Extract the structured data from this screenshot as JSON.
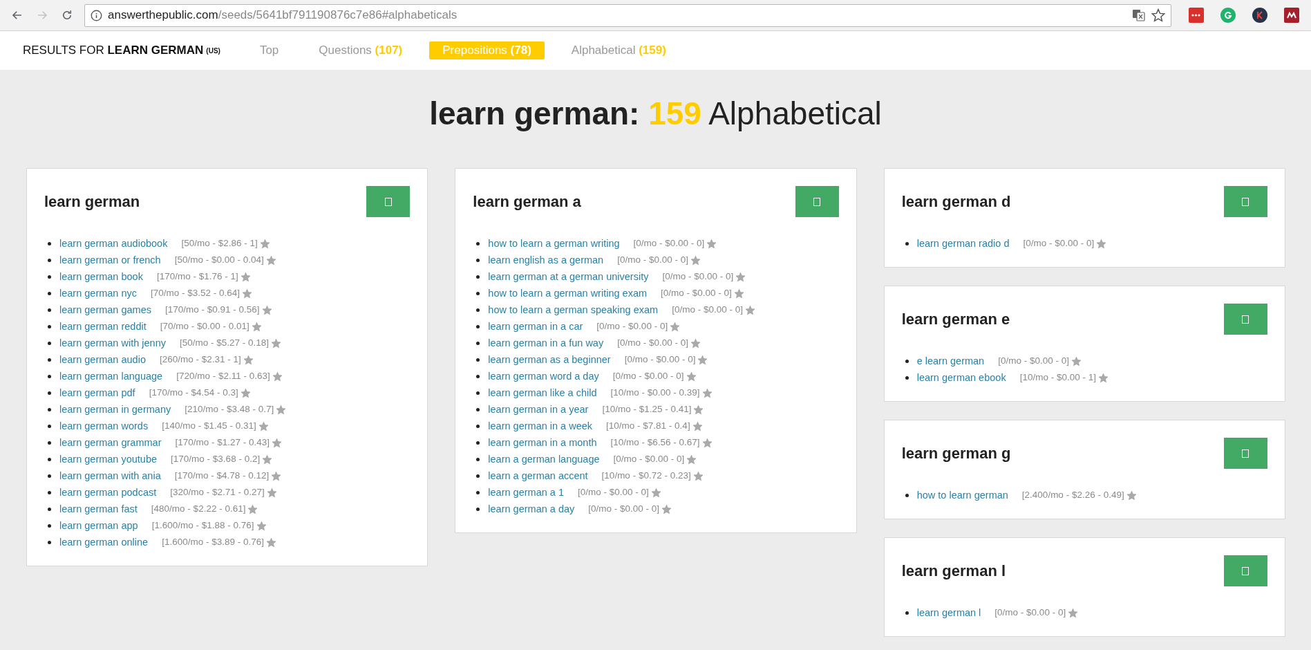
{
  "browser": {
    "url_host": "answerthepublic.com",
    "url_path": "/seeds/5641bf791190876c7e86#alphabeticals",
    "forward_disabled": true
  },
  "nav": {
    "results_label": "RESULTS FOR **LEARN GERMAN**",
    "region": "(US)",
    "tabs": [
      {
        "label": "Top",
        "selected": false
      },
      {
        "label": "Questions",
        "count": "(107)",
        "selected": false
      },
      {
        "label": "Prepositions",
        "count": "(78)",
        "selected": true
      },
      {
        "label": "Alphabetical",
        "count": "(159)",
        "selected": false
      }
    ]
  },
  "heading": {
    "seed": "learn german:",
    "count": "159",
    "label": "Alphabetical"
  },
  "columns": [
    [
      {
        "title": "learn german",
        "items": [
          {
            "phrase": "learn german audiobook",
            "stats": "[50/mo - $2.86 - 1]"
          },
          {
            "phrase": "learn german or french",
            "stats": "[50/mo - $0.00 - 0.04]"
          },
          {
            "phrase": "learn german book",
            "stats": "[170/mo - $1.76 - 1]"
          },
          {
            "phrase": "learn german nyc",
            "stats": "[70/mo - $3.52 - 0.64]"
          },
          {
            "phrase": "learn german games",
            "stats": "[170/mo - $0.91 - 0.56]"
          },
          {
            "phrase": "learn german reddit",
            "stats": "[70/mo - $0.00 - 0.01]"
          },
          {
            "phrase": "learn german with jenny",
            "stats": "[50/mo - $5.27 - 0.18]"
          },
          {
            "phrase": "learn german audio",
            "stats": "[260/mo - $2.31 - 1]"
          },
          {
            "phrase": "learn german language",
            "stats": "[720/mo - $2.11 - 0.63]"
          },
          {
            "phrase": "learn german pdf",
            "stats": "[170/mo - $4.54 - 0.3]"
          },
          {
            "phrase": "learn german in germany",
            "stats": "[210/mo - $3.48 - 0.7]"
          },
          {
            "phrase": "learn german words",
            "stats": "[140/mo - $1.45 - 0.31]"
          },
          {
            "phrase": "learn german grammar",
            "stats": "[170/mo - $1.27 - 0.43]"
          },
          {
            "phrase": "learn german youtube",
            "stats": "[170/mo - $3.68 - 0.2]"
          },
          {
            "phrase": "learn german with ania",
            "stats": "[170/mo - $4.78 - 0.12]"
          },
          {
            "phrase": "learn german podcast",
            "stats": "[320/mo - $2.71 - 0.27]"
          },
          {
            "phrase": "learn german fast",
            "stats": "[480/mo - $2.22 - 0.61]"
          },
          {
            "phrase": "learn german app",
            "stats": "[1.600/mo - $1.88 - 0.76]"
          },
          {
            "phrase": "learn german online",
            "stats": "[1.600/mo - $3.89 - 0.76]"
          }
        ]
      }
    ],
    [
      {
        "title": "learn german a",
        "items": [
          {
            "phrase": "how to learn a german writing",
            "stats": "[0/mo - $0.00 - 0]"
          },
          {
            "phrase": "learn english as a german",
            "stats": "[0/mo - $0.00 - 0]"
          },
          {
            "phrase": "learn german at a german university",
            "stats": "[0/mo - $0.00 - 0]"
          },
          {
            "phrase": "how to learn a german writing exam",
            "stats": "[0/mo - $0.00 - 0]"
          },
          {
            "phrase": "how to learn a german speaking exam",
            "stats": "[0/mo - $0.00 - 0]"
          },
          {
            "phrase": "learn german in a car",
            "stats": "[0/mo - $0.00 - 0]"
          },
          {
            "phrase": "learn german in a fun way",
            "stats": "[0/mo - $0.00 - 0]"
          },
          {
            "phrase": "learn german as a beginner",
            "stats": "[0/mo - $0.00 - 0]"
          },
          {
            "phrase": "learn german word a day",
            "stats": "[0/mo - $0.00 - 0]"
          },
          {
            "phrase": "learn german like a child",
            "stats": "[10/mo - $0.00 - 0.39]"
          },
          {
            "phrase": "learn german in a year",
            "stats": "[10/mo - $1.25 - 0.41]"
          },
          {
            "phrase": "learn german in a week",
            "stats": "[10/mo - $7.81 - 0.4]"
          },
          {
            "phrase": "learn german in a month",
            "stats": "[10/mo - $6.56 - 0.67]"
          },
          {
            "phrase": "learn a german language",
            "stats": "[0/mo - $0.00 - 0]"
          },
          {
            "phrase": "learn a german accent",
            "stats": "[10/mo - $0.72 - 0.23]"
          },
          {
            "phrase": "learn german a 1",
            "stats": "[0/mo - $0.00 - 0]"
          },
          {
            "phrase": "learn german a day",
            "stats": "[0/mo - $0.00 - 0]"
          }
        ]
      }
    ],
    [
      {
        "title": "learn german d",
        "items": [
          {
            "phrase": "learn german radio d",
            "stats": "[0/mo - $0.00 - 0]"
          }
        ]
      },
      {
        "title": "learn german e",
        "items": [
          {
            "phrase": "e learn german",
            "stats": "[0/mo - $0.00 - 0]"
          },
          {
            "phrase": "learn german ebook",
            "stats": "[10/mo - $0.00 - 1]"
          }
        ]
      },
      {
        "title": "learn german g",
        "items": [
          {
            "phrase": "how to learn german",
            "stats": "[2.400/mo - $2.26 - 0.49]"
          }
        ]
      },
      {
        "title": "learn german l",
        "items": [
          {
            "phrase": "learn german l",
            "stats": "[0/mo - $0.00 - 0]"
          }
        ]
      }
    ]
  ]
}
